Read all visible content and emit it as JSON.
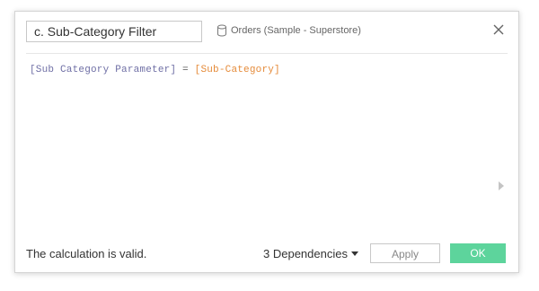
{
  "header": {
    "calc_name": "c. Sub-Category Filter",
    "datasource_icon": "database-icon",
    "datasource_label": "Orders (Sample - Superstore)",
    "close_icon": "close-icon"
  },
  "editor": {
    "formula_param": "[Sub Category Parameter]",
    "formula_op": " = ",
    "formula_field": "[Sub-Category]",
    "colors": {
      "param": "#6f6fa5",
      "field": "#e58b3a"
    }
  },
  "footer": {
    "status": "The calculation is valid.",
    "dependencies_label": "3 Dependencies",
    "apply_label": "Apply",
    "ok_label": "OK",
    "ok_color": "#5dd49c"
  }
}
